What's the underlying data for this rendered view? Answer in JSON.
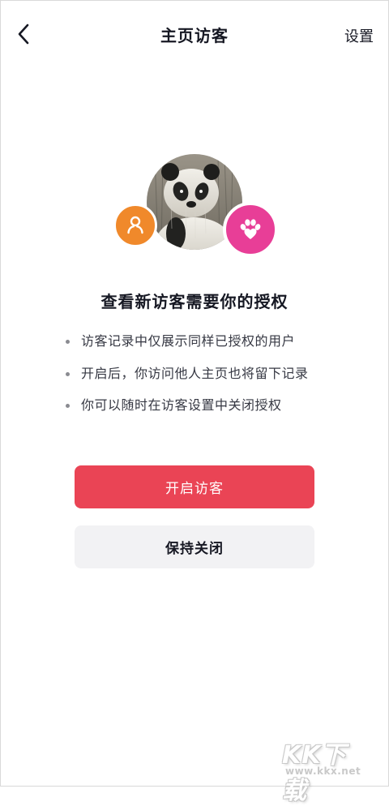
{
  "header": {
    "title": "主页访客",
    "settings_label": "设置"
  },
  "icons": {
    "back": "chevron-left-icon",
    "user": "user-icon",
    "paw": "paw-heart-icon"
  },
  "colors": {
    "primary": "#ea4455",
    "user_badge": "#f0892b",
    "paw_badge": "#e83e97",
    "secondary_button": "#f2f2f4"
  },
  "main": {
    "heading": "查看新访客需要你的授权",
    "bullets": [
      "访客记录中仅展示同样已授权的用户",
      "开启后，你访问他人主页也将留下记录",
      "你可以随时在访客设置中关闭授权"
    ],
    "enable_button": "开启访客",
    "keep_closed_button": "保持关闭"
  },
  "watermark": {
    "logo": "KK下载",
    "url": "www.kkx.net"
  }
}
